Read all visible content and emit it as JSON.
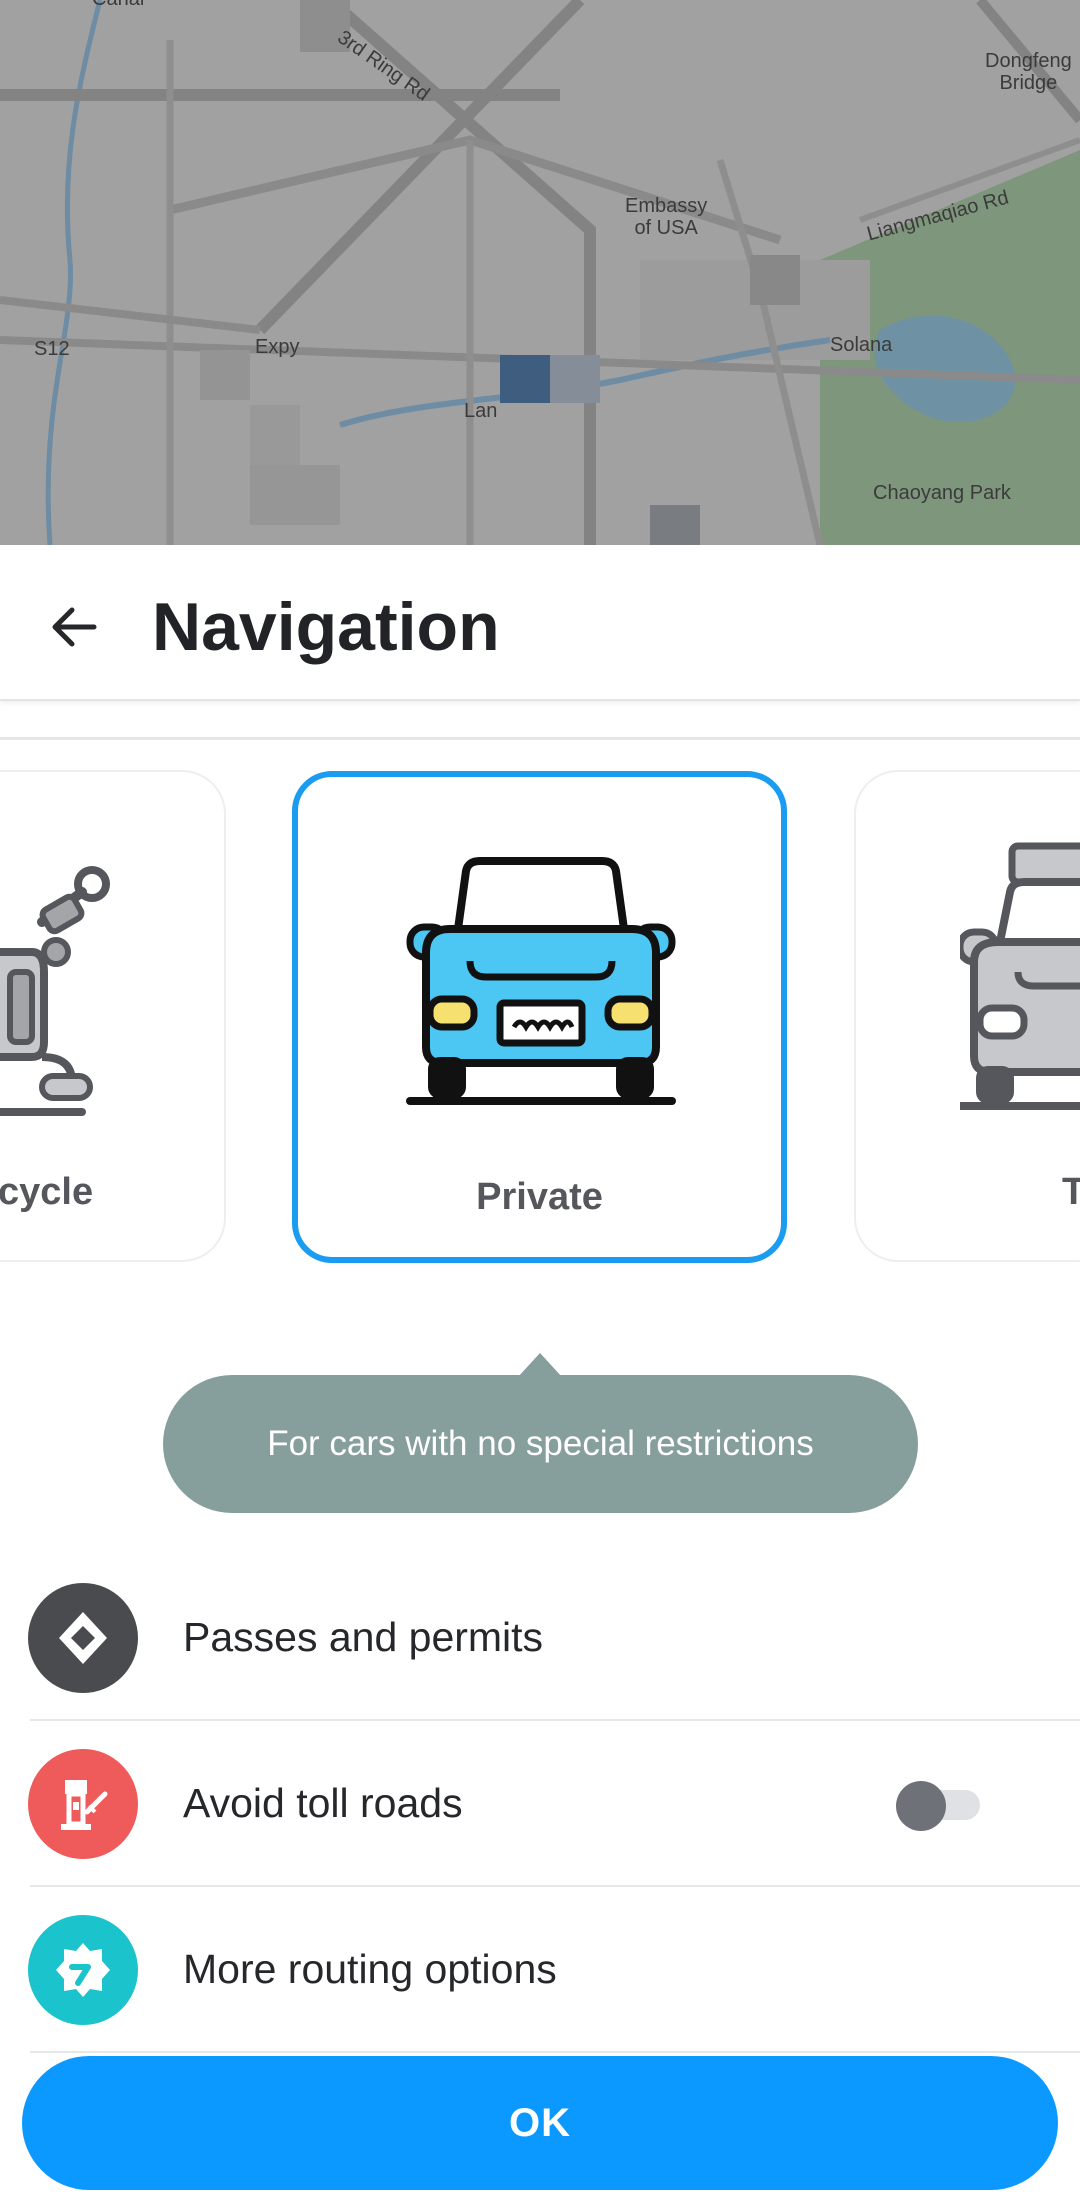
{
  "map": {
    "labels": {
      "ring_road": "3rd Ring Rd",
      "embassy": "Embassy\nof USA",
      "dongfeng": "Dongfeng\nBridge",
      "liangmaqiao": "Liangmaqiao Rd",
      "solana": "Solana",
      "expy": "Expy",
      "s12": "S12",
      "lane": "Lan",
      "chaoyang_park": "Chaoyang Park",
      "canal": "Canal"
    }
  },
  "header": {
    "title": "Navigation"
  },
  "vehicles": {
    "left_label": "cycle",
    "center_label": "Private",
    "right_label": "T"
  },
  "tooltip": {
    "text": "For cars with no special restrictions"
  },
  "options": [
    {
      "label": "Passes and permits",
      "icon_color": "#4a4b4f"
    },
    {
      "label": "Avoid toll roads",
      "icon_color": "#ef5b5b",
      "toggle_on": false
    },
    {
      "label": "More routing options",
      "icon_color": "#1bc3cc"
    }
  ],
  "ok_button": {
    "label": "OK"
  },
  "colors": {
    "accent": "#0b99ff",
    "selected_border": "#1a9cf0",
    "tooltip_bg": "#869f9c",
    "car_body": "#4cc7f4"
  }
}
